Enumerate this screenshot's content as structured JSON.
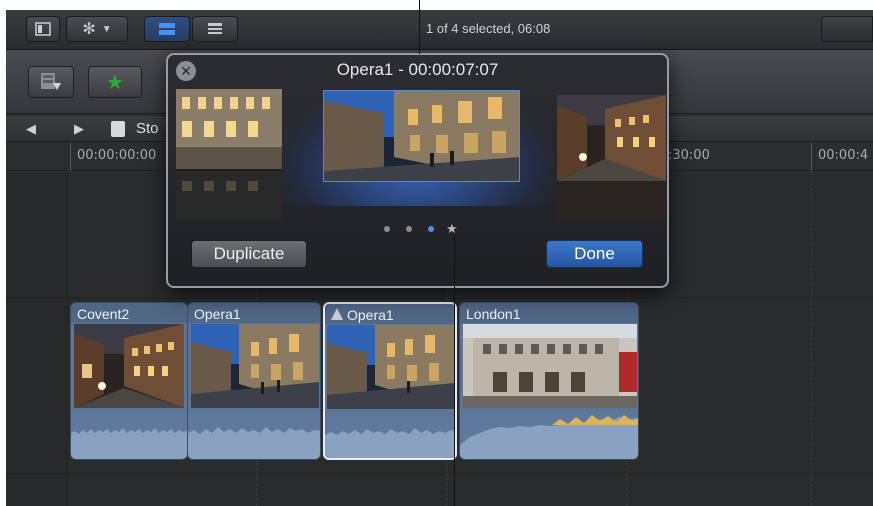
{
  "toolbar": {
    "status": "1 of 4 selected, 06:08",
    "icons": [
      "sidebar-toggle-icon",
      "gear-icon",
      "chevron-down-icon",
      "filmstrip-view-icon",
      "list-view-icon",
      "import-icon",
      "star-icon"
    ]
  },
  "breadcrumb": {
    "back": "◀",
    "forward": "▶",
    "title": "Sto"
  },
  "ruler": {
    "timecodes": [
      "00:00:00:00",
      "00:00:30:00",
      "00:00:4"
    ]
  },
  "popover": {
    "title": "Opera1 - 00:00:07:07",
    "duplicate_label": "Duplicate",
    "done_label": "Done",
    "close_glyph": "✕",
    "pagination": {
      "count": 4,
      "active_index": 2,
      "last_is_star": true
    }
  },
  "clips": [
    {
      "name": "Covent2",
      "selected": false,
      "scene": "night"
    },
    {
      "name": "Opera1",
      "selected": false,
      "scene": "opera"
    },
    {
      "name": "Opera1",
      "selected": true,
      "scene": "opera"
    },
    {
      "name": "London1",
      "selected": false,
      "scene": "facade"
    }
  ],
  "colors": {
    "accent_blue": "#2454a0",
    "clip_blue": "#5d7698",
    "active_dot": "#4b8ff5"
  }
}
